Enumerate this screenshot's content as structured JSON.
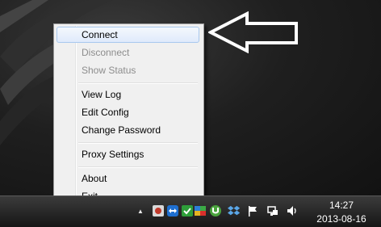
{
  "context_menu": {
    "items": [
      {
        "label": "Connect"
      },
      {
        "label": "Disconnect"
      },
      {
        "label": "Show Status"
      },
      {
        "label": "View Log"
      },
      {
        "label": "Edit Config"
      },
      {
        "label": "Change Password"
      },
      {
        "label": "Proxy Settings"
      },
      {
        "label": "About"
      },
      {
        "label": "Exit"
      }
    ]
  },
  "taskbar": {
    "tray_icons": [
      "show-hidden-icons-chevron",
      "openvpn-tray-icon",
      "teamviewer-icon",
      "green-check-icon",
      "network-app-icon",
      "utorrent-icon",
      "dropbox-icon",
      "action-center-flag-icon",
      "network-icon",
      "volume-icon"
    ],
    "clock": {
      "time": "14:27",
      "date": "2013-08-16"
    }
  },
  "colors": {
    "menu_background": "#f0f0f0",
    "menu_highlight_border": "#a8c8ee",
    "disabled_text": "#8d8d8d",
    "taskbar": "#1f1f1f"
  }
}
